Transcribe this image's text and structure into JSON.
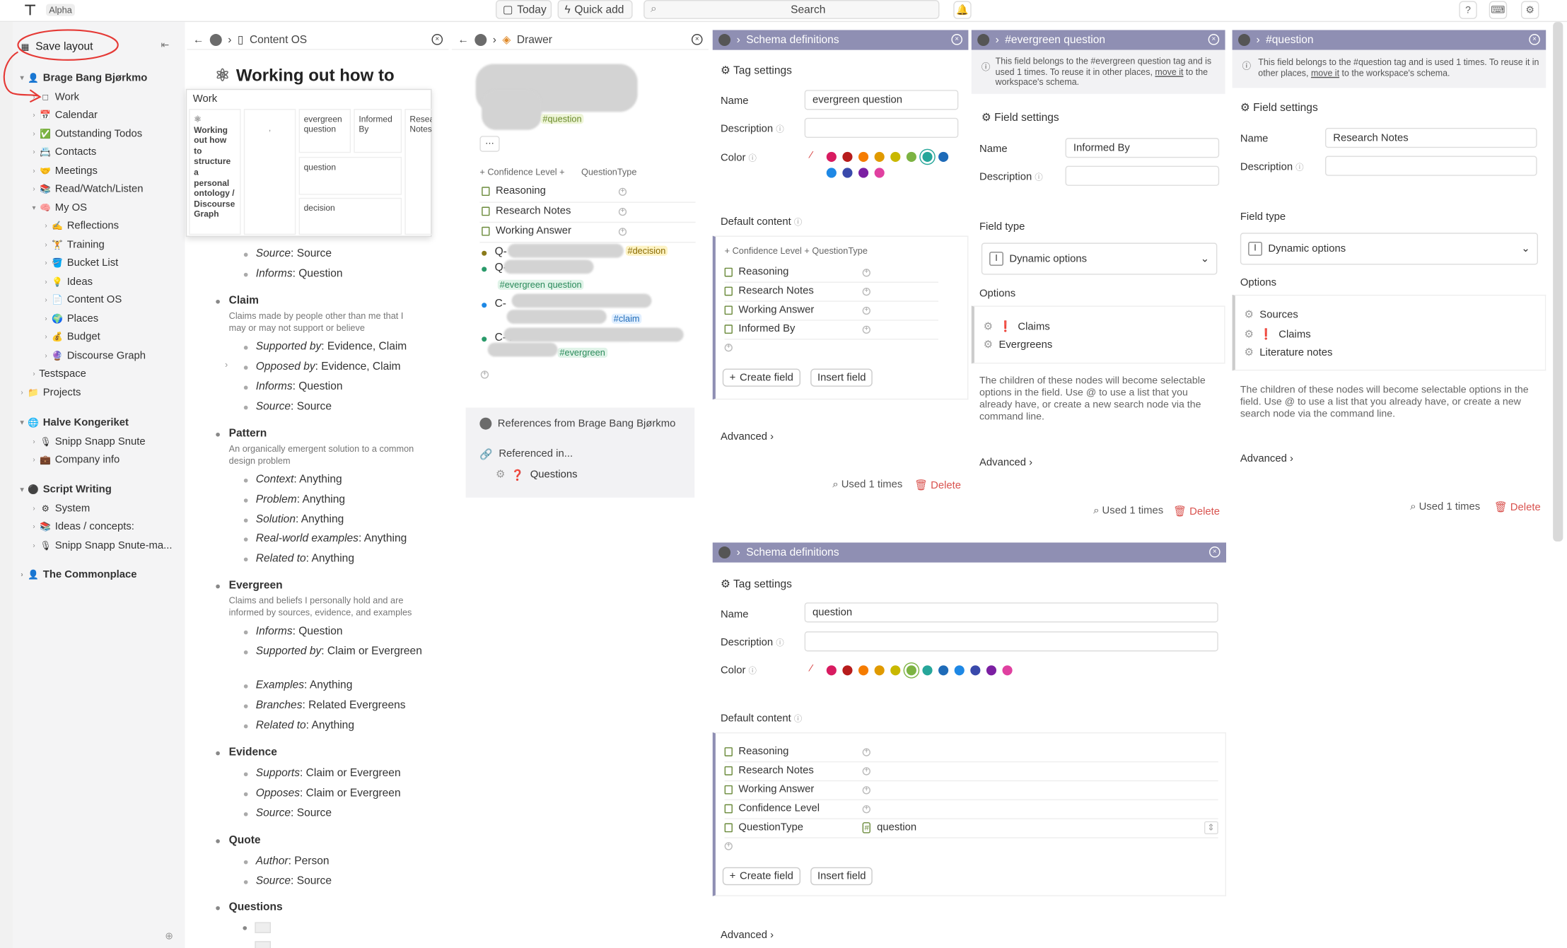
{
  "topbar": {
    "badge": "Alpha",
    "today": "Today",
    "quick_add": "Quick add",
    "search": "Search"
  },
  "sidebar": {
    "save_layout": "Save layout",
    "items": [
      {
        "label": "Brage Bang Bjørkmo",
        "icon": "👤",
        "level": 0,
        "bold": true
      },
      {
        "label": "Work",
        "icon": "□",
        "level": 1
      },
      {
        "label": "Calendar",
        "icon": "📅",
        "level": 1
      },
      {
        "label": "Outstanding Todos",
        "icon": "✅",
        "level": 1
      },
      {
        "label": "Contacts",
        "icon": "📇",
        "level": 1
      },
      {
        "label": "Meetings",
        "icon": "🤝",
        "level": 1
      },
      {
        "label": "Read/Watch/Listen",
        "icon": "📚",
        "level": 1
      },
      {
        "label": "My OS",
        "icon": "🧠",
        "level": 1
      },
      {
        "label": "Reflections",
        "icon": "✍",
        "level": 2
      },
      {
        "label": "Training",
        "icon": "🏋",
        "level": 2
      },
      {
        "label": "Bucket List",
        "icon": "🪣",
        "level": 2
      },
      {
        "label": "Ideas",
        "icon": "💡",
        "level": 2
      },
      {
        "label": "Content OS",
        "icon": "📄",
        "level": 2
      },
      {
        "label": "Places",
        "icon": "🌍",
        "level": 2
      },
      {
        "label": "Budget",
        "icon": "💰",
        "level": 2
      },
      {
        "label": "Discourse Graph",
        "icon": "🔮",
        "level": 2
      },
      {
        "label": "Testspace",
        "icon": "",
        "level": 1
      },
      {
        "label": "Projects",
        "icon": "📁",
        "level": 0
      },
      {
        "label": "Halve Kongeriket",
        "icon": "🌐",
        "level": 0,
        "bold": true
      },
      {
        "label": "Snipp Snapp Snute",
        "icon": "🎙",
        "level": 1
      },
      {
        "label": "Company info",
        "icon": "💼",
        "level": 1
      },
      {
        "label": "Script Writing",
        "icon": "⚫",
        "level": 0,
        "bold": true
      },
      {
        "label": "System",
        "icon": "⚙",
        "level": 1
      },
      {
        "label": "Ideas / concepts:",
        "icon": "📚",
        "level": 1
      },
      {
        "label": "Snipp Snapp Snute-ma...",
        "icon": "🎙",
        "level": 1
      },
      {
        "label": "The Commonplace",
        "icon": "👤",
        "level": 0,
        "bold": true
      }
    ]
  },
  "content_os": {
    "breadcrumb": "Content OS",
    "title": "Working out how to",
    "popup": {
      "title": "Work",
      "card_text": "Working out how to structure a personal ontology / Discourse Graph",
      "col2": ",",
      "col3": [
        "evergreen question",
        "question",
        "decision"
      ],
      "col4": "Informed By",
      "col5": "Research Notes"
    },
    "source_a": "Source",
    "source_a_val": "Source",
    "informs_a": "Informs",
    "informs_a_val": "Question",
    "sections": [
      {
        "title": "Claim",
        "desc": "Claims made by people other than me that I may or may not support or believe",
        "fields": [
          [
            "Supported by",
            "Evidence, Claim"
          ],
          [
            "Opposed by",
            "Evidence, Claim"
          ],
          [
            "Informs",
            "Question"
          ],
          [
            "Source",
            "Source"
          ]
        ]
      },
      {
        "title": "Pattern",
        "desc": "An organically emergent solution to a common design problem",
        "fields": [
          [
            "Context",
            "Anything"
          ],
          [
            "Problem",
            "Anything"
          ],
          [
            "Solution",
            "Anything"
          ],
          [
            "Real-world examples",
            "Anything"
          ],
          [
            "Related to",
            "Anything"
          ]
        ]
      },
      {
        "title": "Evergreen",
        "desc": "Claims and beliefs I personally hold and are informed by sources, evidence, and examples",
        "fields": [
          [
            "Informs",
            "Question"
          ],
          [
            "Supported by",
            "Claim or Evergreen"
          ],
          [
            "Examples",
            "Anything"
          ],
          [
            "Branches",
            "Related Evergreens"
          ],
          [
            "Related to",
            "Anything"
          ]
        ]
      },
      {
        "title": "Evidence",
        "desc": "",
        "fields": [
          [
            "Supports",
            "Claim or Evergreen"
          ],
          [
            "Opposes",
            "Claim or Evergreen"
          ],
          [
            "Source",
            "Source"
          ]
        ]
      },
      {
        "title": "Quote",
        "desc": "",
        "fields": [
          [
            "Author",
            "Person"
          ],
          [
            "Source",
            "Source"
          ]
        ]
      },
      {
        "title": "Questions",
        "desc": "",
        "fields": []
      }
    ]
  },
  "drawer": {
    "breadcrumb": "Drawer",
    "tag": "#question",
    "menu": "···",
    "add_fields": [
      "Confidence Level",
      "QuestionType"
    ],
    "fields": [
      "Reasoning",
      "Research Notes",
      "Working Answer"
    ],
    "items": [
      {
        "prefix": "Q-",
        "tag": "#decision"
      },
      {
        "prefix": "Q-",
        "tag": "#evergreen question"
      },
      {
        "prefix": "C-",
        "tag": "#claim"
      },
      {
        "prefix": "C- F",
        "tag": "#evergreen"
      }
    ],
    "refs_title": "References from Brage Bang Bjørkmo",
    "referenced_in": "Referenced in...",
    "ref_item": "Questions"
  },
  "schema1": {
    "header": "Schema definitions",
    "tag_settings": "Tag settings",
    "name_label": "Name",
    "name_value": "evergreen question",
    "desc_label": "Description",
    "color_label": "Color",
    "default_content": "Default content",
    "add_fields": [
      "Confidence Level",
      "QuestionType"
    ],
    "fields": [
      "Reasoning",
      "Research Notes",
      "Working Answer",
      "Informed By"
    ],
    "create_field": "Create field",
    "insert_field": "Insert field",
    "advanced": "Advanced",
    "used": "Used 1 times",
    "delete": "Delete"
  },
  "evergreen_panel": {
    "header": "#evergreen question",
    "notice_pre": "This field belongs to the #evergreen question tag and is used 1 times. To reuse it in other places,",
    "notice_link": "move it",
    "notice_post": "to the workspace's schema.",
    "field_settings": "Field settings",
    "name_label": "Name",
    "name_value": "Informed By",
    "desc_label": "Description",
    "field_type_label": "Field type",
    "field_type_value": "Dynamic options",
    "options_label": "Options",
    "options": [
      "Claims",
      "Evergreens"
    ],
    "help": "The children of these nodes will become selectable options in the field. Use @ to use a list that you already have, or create a new search node via the command line.",
    "advanced": "Advanced",
    "used": "Used 1 times",
    "delete": "Delete"
  },
  "question_panel": {
    "header": "#question",
    "notice_pre": "This field belongs to the #question tag and is used 1 times. To reuse it in other places,",
    "notice_link": "move it",
    "notice_post": "to the workspace's schema.",
    "field_settings": "Field settings",
    "name_label": "Name",
    "name_value": "Research Notes",
    "desc_label": "Description",
    "field_type_label": "Field type",
    "field_type_value": "Dynamic options",
    "options_label": "Options",
    "options": [
      "Sources",
      "Claims",
      "Literature notes"
    ],
    "help": "The children of these nodes will become selectable options in the field. Use @ to use a list that you already have, or create a new search node via the command line.",
    "advanced": "Advanced",
    "used": "Used 1 times",
    "delete": "Delete"
  },
  "schema2": {
    "header": "Schema definitions",
    "tag_settings": "Tag settings",
    "name_label": "Name",
    "name_value": "question",
    "desc_label": "Description",
    "color_label": "Color",
    "default_content": "Default content",
    "fields": [
      "Reasoning",
      "Research Notes",
      "Working Answer",
      "Confidence Level",
      "QuestionType"
    ],
    "questiontype_value": "question",
    "create_field": "Create field",
    "insert_field": "Insert field",
    "advanced": "Advanced"
  },
  "colors": {
    "palette": [
      "#d81b60",
      "#b71c1c",
      "#f57c00",
      "#e09a00",
      "#c9b800",
      "#7cb342",
      "#26a69a",
      "#1e6bb8",
      "#1e88e5",
      "#3949ab",
      "#7b1fa2",
      "#e040a0"
    ],
    "schema_header": "#8f8fb3",
    "annotation": "#e53935"
  }
}
